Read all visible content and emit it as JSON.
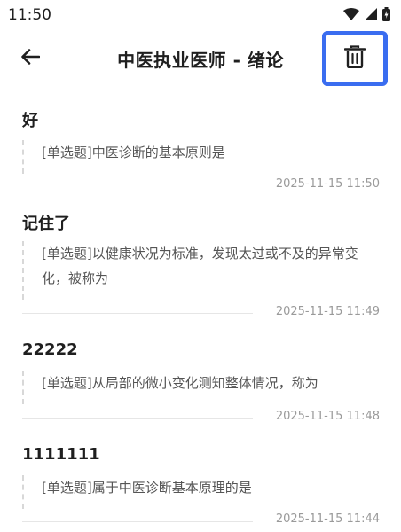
{
  "status_bar": {
    "time": "11:50",
    "icons": [
      "wifi-icon",
      "signal-icon",
      "battery-icon"
    ]
  },
  "header": {
    "title": "中医执业医师 - 绪论",
    "back_icon": "arrow-left-icon",
    "delete_icon": "trash-icon",
    "highlight_color": "#3a6df0"
  },
  "notes": [
    {
      "title": "好",
      "question": "[单选题]中医诊断的基本原则是",
      "timestamp": "2025-11-15 11:50"
    },
    {
      "title": "记住了",
      "question": "[单选题]以健康状况为标准，发现太过或不及的异常变化，被称为",
      "timestamp": "2025-11-15 11:49"
    },
    {
      "title": "22222",
      "question": "[单选题]从局部的微小变化测知整体情况，称为",
      "timestamp": "2025-11-15 11:48"
    },
    {
      "title": "1111111",
      "question": "[单选题]属于中医诊断基本原理的是",
      "timestamp": "2025-11-15 11:44"
    }
  ]
}
